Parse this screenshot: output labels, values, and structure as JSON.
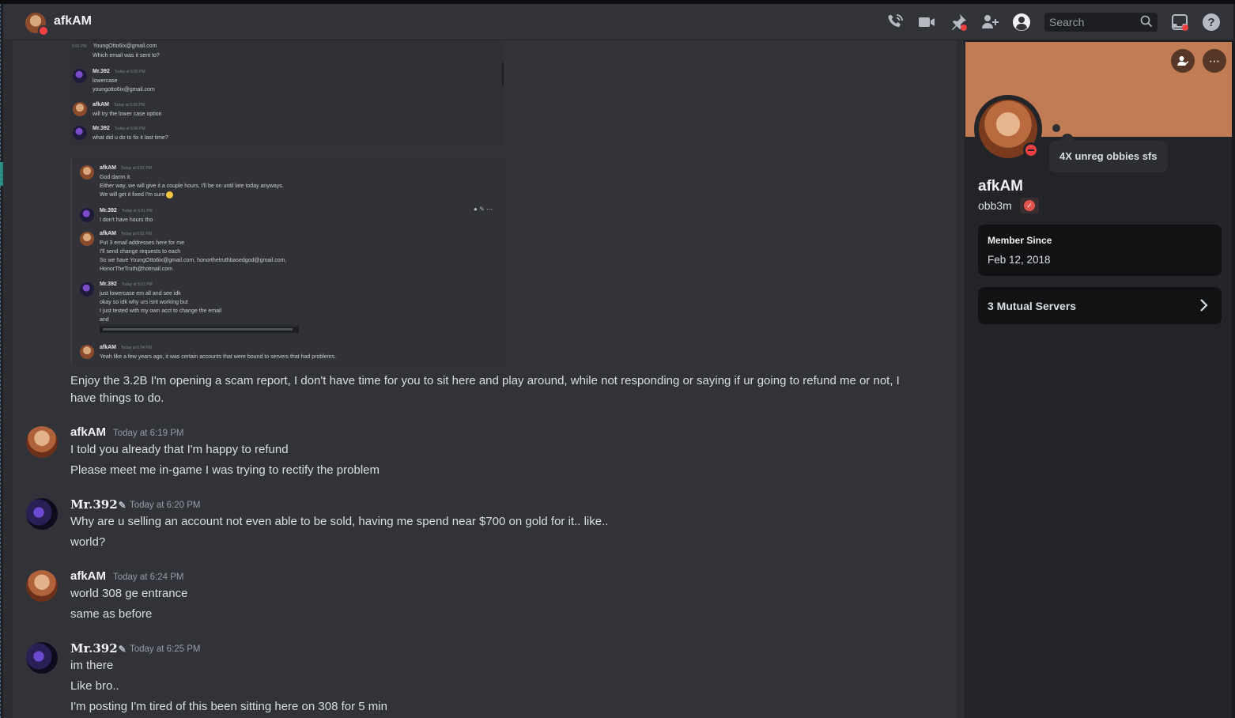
{
  "header": {
    "title": "afkAM",
    "search_placeholder": "Search"
  },
  "screenshot": {
    "part1": [
      {
        "time": "5:55 PM",
        "lines": [
          "YoungOtto6ix@gmail.com",
          "Which email was it sent to?"
        ]
      },
      {
        "name": "Mr.392",
        "time": "Today at 5:55 PM",
        "lines": [
          "lowercase",
          "youngotto6ix@gmail.com"
        ]
      },
      {
        "name": "afkAM",
        "time": "Today at 5:55 PM",
        "lines": [
          "will try the lower case option"
        ]
      },
      {
        "name": "Mr.392",
        "time": "Today at 5:56 PM",
        "lines": [
          "what did u do to fix it last time?"
        ]
      }
    ],
    "part2": [
      {
        "name": "afkAM",
        "time": "Today at 6:01 PM",
        "lines": [
          "God damn it.",
          "Either way, we will give it a couple hours, I'll be on until late today anyways.",
          "We will get it fixed I'm sure"
        ]
      },
      {
        "name": "Mr.392",
        "time": "Today at 6:01 PM",
        "lines": [
          "I don't have hours tho"
        ]
      },
      {
        "name": "afkAM",
        "time": "Today at 6:01 PM",
        "lines": [
          "Put 3 email addresses here for me",
          "I'll send change requests to each",
          "So we have YoungOtto6ix@gmail.com, honorthetruthbasedgod@gmail.com,",
          "HonorTheTruth@hotmail.com"
        ]
      },
      {
        "name": "Mr.392",
        "time": "Today at 6:02 PM",
        "lines": [
          "just lowercase em all and see idk",
          "okay so idk why urs isnt working but",
          "I just tested with my own acct to change the email",
          "and"
        ]
      },
      {
        "name": "afkAM",
        "time": "Today at 6:04 PM",
        "lines": [
          "Yeah like a few years ago, it was certain accounts that were bound to servers that had problems."
        ]
      }
    ]
  },
  "messages": {
    "continuation": [
      "Enjoy the 3.2B I'm opening a scam report, I don't have time for you to sit here and play around, while not responding or saying if ur going to refund me or not, I",
      "have things to do."
    ],
    "groups": [
      {
        "author": "afkAM",
        "time": "Today at 6:19 PM",
        "lines": [
          "I told you already that I'm happy to refund",
          "Please meet me in-game I was trying to rectify the problem"
        ]
      },
      {
        "author": "Mr.392",
        "time": "Today at 6:20 PM",
        "lines": [
          "Why are u selling an account not even able to be sold, having me spend near $700 on gold for it.. like..",
          "world?"
        ]
      },
      {
        "author": "afkAM",
        "time": "Today at 6:24 PM",
        "lines": [
          "world 308 ge entrance",
          "same as before"
        ]
      },
      {
        "author": "Mr.392",
        "time": "Today at 6:25 PM",
        "lines": [
          "im there",
          "Like bro..",
          "I'm posting I'm tired of this been sitting here on 308 for 5 min"
        ]
      }
    ]
  },
  "profile": {
    "display_name": "afkAM",
    "username": "obb3m",
    "status_text": "4X unreg obbies sfs",
    "member_since_label": "Member Since",
    "member_since_value": "Feb 12, 2018",
    "mutual_servers": "3 Mutual Servers",
    "banner_color": "#c27c55"
  },
  "icons": [
    "voice-call-icon",
    "video-call-icon",
    "pin-icon",
    "add-friends-icon",
    "user-profile-icon",
    "search-icon",
    "inbox-icon",
    "help-icon",
    "add-friend-icon",
    "more-icon",
    "chevron-right-icon"
  ]
}
